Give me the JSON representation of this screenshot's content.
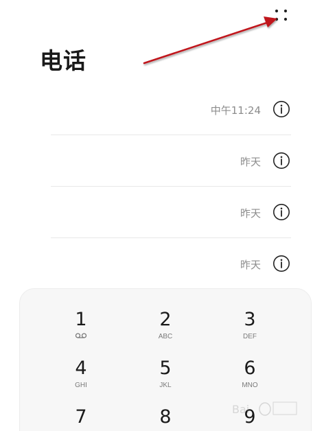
{
  "header": {
    "title": "电话",
    "more_icon": "more-dots-icon"
  },
  "call_log": [
    {
      "time": "中午11:24",
      "icon": "info-icon"
    },
    {
      "time": "昨天",
      "icon": "info-icon"
    },
    {
      "time": "昨天",
      "icon": "info-icon"
    },
    {
      "time": "昨天",
      "icon": "info-icon"
    }
  ],
  "dialpad": {
    "keys": [
      {
        "digit": "1",
        "letters": "",
        "icon": "voicemail-icon"
      },
      {
        "digit": "2",
        "letters": "ABC"
      },
      {
        "digit": "3",
        "letters": "DEF"
      },
      {
        "digit": "4",
        "letters": "GHI"
      },
      {
        "digit": "5",
        "letters": "JKL"
      },
      {
        "digit": "6",
        "letters": "MNO"
      },
      {
        "digit": "7",
        "letters": ""
      },
      {
        "digit": "8",
        "letters": ""
      },
      {
        "digit": "9",
        "letters": ""
      }
    ]
  },
  "colors": {
    "annotation_arrow": "#c0141b",
    "text_primary": "#1a1a1a",
    "text_secondary": "#8c8c8c",
    "dialpad_bg": "#f7f7f7"
  }
}
